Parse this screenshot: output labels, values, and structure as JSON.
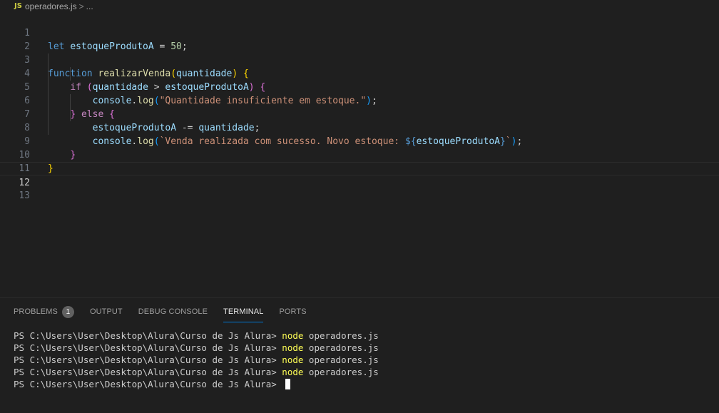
{
  "breadcrumb": {
    "icon_text": "JS",
    "file": "operadores.js",
    "separator": ">",
    "more": "..."
  },
  "editor": {
    "current_line": 12,
    "line_numbers": [
      "1",
      "2",
      "3",
      "4",
      "5",
      "6",
      "7",
      "8",
      "9",
      "10",
      "11",
      "12",
      "13"
    ]
  },
  "panel": {
    "tabs": [
      {
        "label": "PROBLEMS",
        "badge": "1"
      },
      {
        "label": "OUTPUT"
      },
      {
        "label": "DEBUG CONSOLE"
      },
      {
        "label": "TERMINAL"
      },
      {
        "label": "PORTS"
      }
    ],
    "active_tab": "TERMINAL"
  },
  "terminal": {
    "prompt": "PS C:\\Users\\User\\Desktop\\Alura\\Curso de Js Alura> ",
    "command_name": "node",
    "command_arg": " operadores.js",
    "history_count": 4
  },
  "colors": {
    "background": "#1f1f1f",
    "keyword": "#569cd6",
    "control": "#c586c0",
    "function": "#dcdcaa",
    "variable": "#9cdcfe",
    "number": "#b5cea8",
    "string": "#ce9178",
    "active_tab_underline": "#0078d4"
  }
}
